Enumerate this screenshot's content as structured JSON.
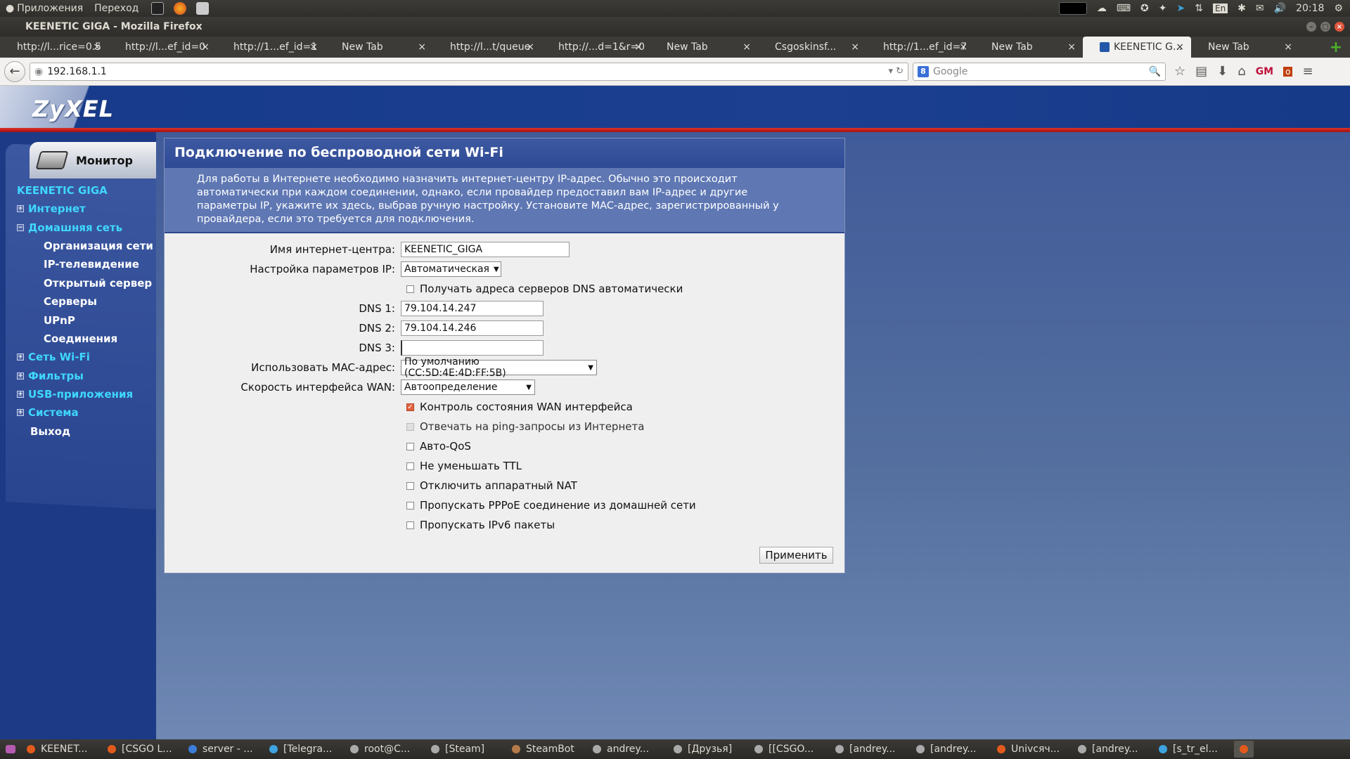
{
  "os_panel": {
    "apps_menu": "Приложения",
    "places_menu": "Переход",
    "clock": "20:18",
    "keyboard_layout": "En"
  },
  "window": {
    "title": "KEENETIC GIGA - Mozilla Firefox"
  },
  "tabs": [
    {
      "label": "http://l...rice=0.5"
    },
    {
      "label": "http://l...ef_id=0"
    },
    {
      "label": "http://1...ef_id=1"
    },
    {
      "label": "New Tab"
    },
    {
      "label": "http://l...t/queue"
    },
    {
      "label": "http://...d=1&r=0"
    },
    {
      "label": "New Tab"
    },
    {
      "label": "Csgoskinsf..."
    },
    {
      "label": "http://1...ef_id=7"
    },
    {
      "label": "New Tab"
    },
    {
      "label": "KEENETIC G..."
    },
    {
      "label": "New Tab"
    }
  ],
  "active_tab_index": 10,
  "navbar": {
    "url": "192.168.1.1",
    "search_placeholder": "Google"
  },
  "brand": {
    "logo_text": "ZyXEL"
  },
  "sidebar": {
    "monitor_label": "Монитор",
    "device_name": "KEENETIC GIGA",
    "items": [
      {
        "label": "Интернет",
        "type": "top",
        "expander": "+"
      },
      {
        "label": "Домашняя сеть",
        "type": "top",
        "expander": "−"
      },
      {
        "label": "Организация сети",
        "type": "sub"
      },
      {
        "label": "IP-телевидение",
        "type": "sub"
      },
      {
        "label": "Открытый сервер",
        "type": "sub"
      },
      {
        "label": "Серверы",
        "type": "sub"
      },
      {
        "label": "UPnP",
        "type": "sub"
      },
      {
        "label": "Соединения",
        "type": "sub"
      },
      {
        "label": "Сеть Wi-Fi",
        "type": "top",
        "expander": "+"
      },
      {
        "label": "Фильтры",
        "type": "top",
        "expander": "+"
      },
      {
        "label": "USB-приложения",
        "type": "top",
        "expander": "+"
      },
      {
        "label": "Система",
        "type": "top",
        "expander": "+"
      },
      {
        "label": "Выход",
        "type": "plain"
      }
    ]
  },
  "main": {
    "title": "Подключение по беспроводной сети Wi-Fi",
    "intro": "Для работы в Интернете необходимо назначить интернет-центру IP-адрес. Обычно это происходит автоматически при каждом соединении, однако, если провайдер предоставил вам IP-адрес и другие параметры IP, укажите их здесь, выбрав ручную настройку. Установите MAC-адрес, зарегистрированный у провайдера, если это требуется для подключения.",
    "fields": {
      "hostname_label": "Имя интернет-центра:",
      "hostname_value": "KEENETIC_GIGA",
      "ip_label": "Настройка параметров IP:",
      "ip_value": "Автоматическая",
      "dns_auto_label": "Получать адреса серверов DNS автоматически",
      "dns1_label": "DNS 1:",
      "dns1_value": "79.104.14.247",
      "dns2_label": "DNS 2:",
      "dns2_value": "79.104.14.246",
      "dns3_label": "DNS 3:",
      "dns3_value": "",
      "mac_label": "Использовать MAC-адрес:",
      "mac_value": "По умолчанию (CC:5D:4E:4D:FF:5B)",
      "wan_speed_label": "Скорость интерфейса WAN:",
      "wan_speed_value": "Автоопределение"
    },
    "checkboxes": [
      {
        "label": "Контроль состояния WAN интерфейса",
        "checked": true,
        "disabled": false
      },
      {
        "label": "Отвечать на ping-запросы из Интернета",
        "checked": false,
        "disabled": true
      },
      {
        "label": "Авто-QoS",
        "checked": false,
        "disabled": false
      },
      {
        "label": "Не уменьшать TTL",
        "checked": false,
        "disabled": false
      },
      {
        "label": "Отключить аппаратный NAT",
        "checked": false,
        "disabled": false
      },
      {
        "label": "Пропускать PPPoE соединение из домашней сети",
        "checked": false,
        "disabled": false
      },
      {
        "label": "Пропускать IPv6 пакеты",
        "checked": false,
        "disabled": false
      }
    ],
    "apply_label": "Применить"
  },
  "taskbar": [
    {
      "label": "KEENET..."
    },
    {
      "label": "[CSGO L..."
    },
    {
      "label": "server - ..."
    },
    {
      "label": "[Telegra..."
    },
    {
      "label": "root@C..."
    },
    {
      "label": "[Steam]"
    },
    {
      "label": "SteamBot"
    },
    {
      "label": "andrey..."
    },
    {
      "label": "[Друзья]"
    },
    {
      "label": "[[CSGO..."
    },
    {
      "label": "[andrey..."
    },
    {
      "label": "[andrey..."
    },
    {
      "label": "Univсяч..."
    },
    {
      "label": "[andrey..."
    },
    {
      "label": "[s_tr_el..."
    }
  ]
}
